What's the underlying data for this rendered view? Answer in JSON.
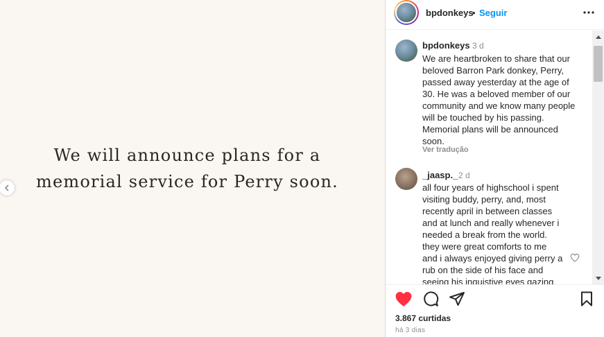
{
  "media": {
    "lines": [
      "We will announce plans for a",
      "memorial service for Perry soon."
    ]
  },
  "header": {
    "username": "bpdonkeys",
    "separator": "•",
    "follow_label": "Seguir",
    "more_icon": "ellipsis-icon"
  },
  "caption": {
    "username": "bpdonkeys",
    "time": "3 d",
    "lines": [
      "We are heartbroken to share that our",
      "beloved Barron Park donkey, Perry,",
      "passed away yesterday at the age of",
      "30. He was a beloved member of our",
      "community and we know many people",
      "will be touched by his passing.",
      "Memorial plans will be announced",
      "soon."
    ],
    "translate_label": "Ver tradução"
  },
  "comment": {
    "username": "_jaasp._",
    "time": "2 d",
    "lines": [
      "all four years of highschool i spent",
      "visiting buddy, perry, and, most",
      "recently april in between classes",
      "and at lunch and really whenever i",
      "needed a break from the world.",
      "they were great comforts to me",
      "and i always enjoyed giving perry a",
      "rub on the side of his face and",
      "seeing his inquistive eyes gazing"
    ]
  },
  "actions": {
    "icons": [
      "heart-filled-icon",
      "comment-icon",
      "share-icon",
      "bookmark-icon"
    ],
    "like_color": "#ff3040",
    "likes_text": "3.867 curtidas",
    "ago_text": "há 3 dias"
  },
  "colors": {
    "follow": "#0095f6",
    "media_bg": "#faf6f2",
    "muted": "#8e8e8e"
  }
}
